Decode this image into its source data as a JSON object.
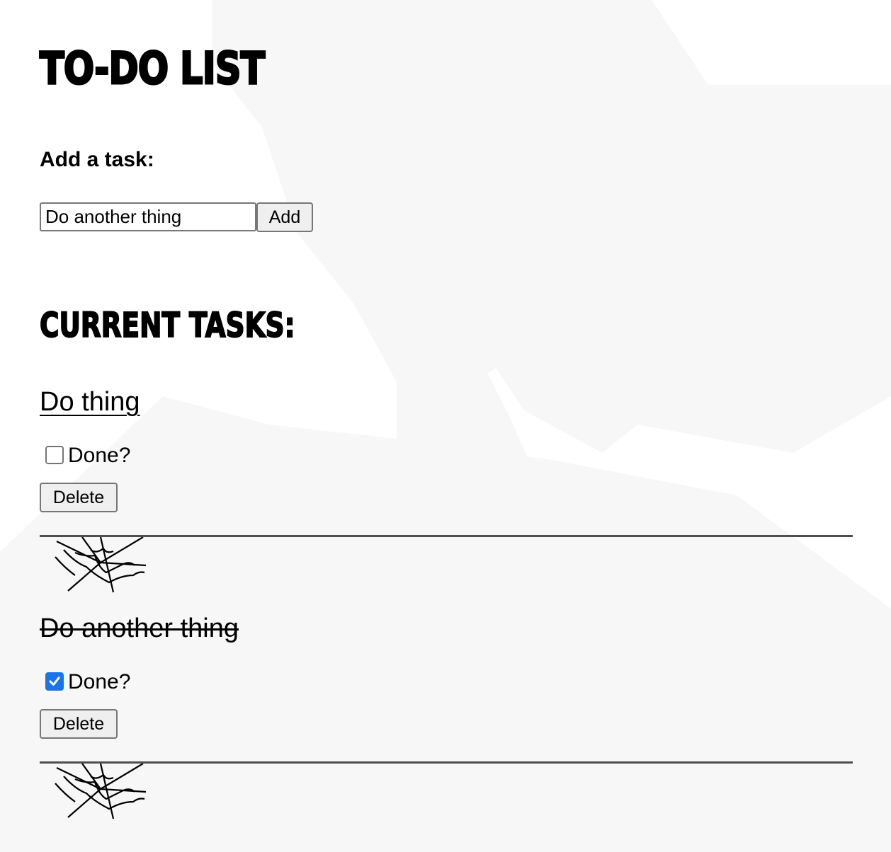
{
  "header": {
    "title": "To-Do List"
  },
  "add_form": {
    "label": "Add a task:",
    "input_value": "Do another thing",
    "add_button_label": "Add"
  },
  "current": {
    "title": "Current Tasks:"
  },
  "tasks": [
    {
      "name": "Do thing",
      "done": false,
      "done_label": "Done?",
      "delete_label": "Delete"
    },
    {
      "name": "Do another thing",
      "done": true,
      "done_label": "Done?",
      "delete_label": "Delete"
    }
  ],
  "icons": {
    "background": "bat-icon",
    "divider": "spider-web-icon",
    "checkbox_checked": "checkmark-icon"
  },
  "colors": {
    "checkbox_accent": "#1a73e8",
    "divider": "#4d4d4d",
    "background_bats": "#f7f7f7"
  }
}
